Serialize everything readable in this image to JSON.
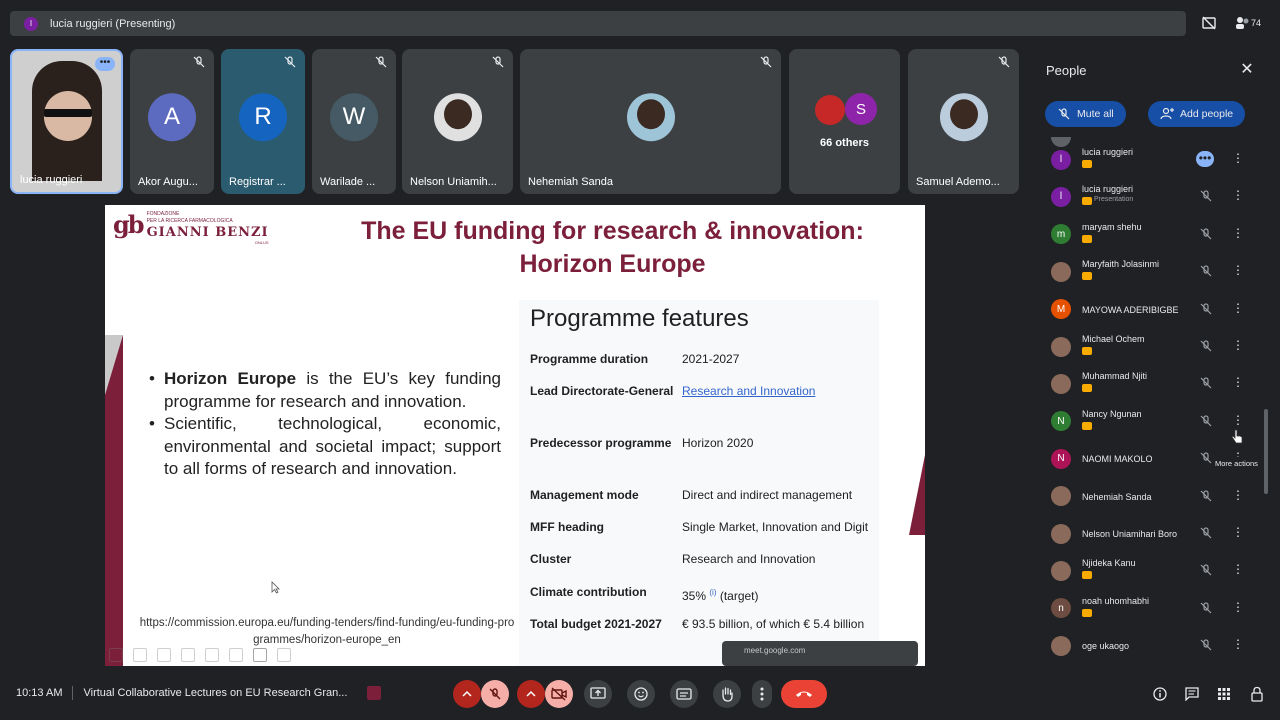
{
  "top_bar": {
    "presenter_initial": "l",
    "presenter_title": "lucia ruggieri (Presenting)",
    "participant_count": "74"
  },
  "tiles": [
    {
      "name": "lucia ruggieri",
      "type": "self"
    },
    {
      "name": "Akor Augu...",
      "type": "letter",
      "letter": "A",
      "color": "#5c6bc0"
    },
    {
      "name": "Registrar ...",
      "type": "letter",
      "letter": "R",
      "color": "#1565c0"
    },
    {
      "name": "Warilade ...",
      "type": "letter",
      "letter": "W",
      "color": "#455a64"
    },
    {
      "name": "Nelson Uniamih...",
      "type": "photo"
    },
    {
      "name": "Nehemiah Sanda",
      "type": "photo"
    },
    {
      "name": "66 others",
      "type": "group",
      "letter": "S",
      "color": "#8e24aa"
    },
    {
      "name": "Samuel Ademo...",
      "type": "photo"
    }
  ],
  "slide": {
    "logo_small": "FONDAZIONE\nPER LA RICERCA FARMACOLOGICA",
    "logo_big": "GIANNI BENZI",
    "logo_tiny": "ONLUS",
    "title_line1": "The EU funding for research & innovation:",
    "title_line2": "Horizon Europe",
    "bullet1_bold": "Horizon Europe",
    "bullet1_rest": " is the EU’s key funding programme for research and innovation.",
    "bullet2": "Scientific, technological, economic, environmental and societal impact; support to all forms of research and innovation.",
    "url": "https://commission.europa.eu/funding-tenders/find-funding/eu-funding-programmes/horizon-europe_en",
    "features_title": "Programme features",
    "features": [
      {
        "key": "Programme duration",
        "value": "2021-2027"
      },
      {
        "key": "Lead Directorate-General",
        "value": "Research and Innovation",
        "link": true
      },
      {
        "key": "Predecessor programme",
        "value": "Horizon 2020"
      },
      {
        "key": "Management mode",
        "value": "Direct and indirect management"
      },
      {
        "key": "MFF heading",
        "value": "Single Market, Innovation and Digit"
      },
      {
        "key": "Cluster",
        "value": "Research and Innovation"
      },
      {
        "key": "Climate contribution",
        "value": "35%",
        "sup": "(i)",
        "value_after": " (target)"
      },
      {
        "key": "Total budget 2021-2027",
        "value": "€ 93.5 billion, of which € 5.4 billion"
      }
    ],
    "popup_text": "meet.google.com"
  },
  "people_panel": {
    "title": "People",
    "mute_all_label": "Mute all",
    "add_people_label": "Add people",
    "tooltip": "More actions",
    "rows": [
      {
        "name": "lucia ruggieri",
        "initial": "l",
        "color": "#7b1fa2",
        "tag": true,
        "active_more": true
      },
      {
        "name": "lucia ruggieri",
        "initial": "l",
        "color": "#7b1fa2",
        "tag": true,
        "sub": "Presentation"
      },
      {
        "name": "maryam shehu",
        "initial": "m",
        "color": "#2e7d32",
        "tag": true
      },
      {
        "name": "Maryfaith Jolasinmi",
        "photo": true,
        "tag": true
      },
      {
        "name": "MAYOWA ADERIBIGBE",
        "initial": "M",
        "color": "#e65100"
      },
      {
        "name": "Michael Ochem",
        "photo": true,
        "tag": true
      },
      {
        "name": "Muhammad Njiti",
        "photo": true,
        "tag": true
      },
      {
        "name": "Nancy Ngunan",
        "initial": "N",
        "color": "#2e7d32",
        "tag": true
      },
      {
        "name": "NAOMI MAKOLO",
        "initial": "N",
        "color": "#ad1457"
      },
      {
        "name": "Nehemiah Sanda",
        "photo": true
      },
      {
        "name": "Nelson Uniamihari Boro",
        "photo": true
      },
      {
        "name": "Njideka Kanu",
        "photo": true,
        "tag": true
      },
      {
        "name": "noah uhomhabhi",
        "initial": "n",
        "color": "#6d4c41",
        "tag": true
      },
      {
        "name": "oge ukaogo",
        "photo": true
      }
    ]
  },
  "bottom_bar": {
    "time": "10:13 AM",
    "meeting_title": "Virtual Collaborative Lectures on EU Research Gran..."
  },
  "colors": {
    "accent": "#8ab4f8",
    "slide_maroon": "#7b1f3b",
    "hangup_red": "#ea4335"
  }
}
